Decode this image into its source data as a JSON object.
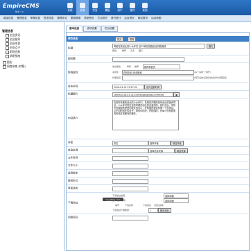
{
  "brand": {
    "logo_text": "EmpireCMS",
    "subtitle": "版本 7.0"
  },
  "top_nav": [
    {
      "label": "系统"
    },
    {
      "label": "信息"
    },
    {
      "label": "栏目"
    },
    {
      "label": "模板"
    },
    {
      "label": "用户"
    },
    {
      "label": "插件"
    },
    {
      "label": "其他"
    }
  ],
  "sub_nav": [
    "增加信息",
    "管理信息",
    "审核信息",
    "签发信息",
    "管理评论",
    "更新数据",
    "更新首页",
    "栏目统计",
    "排行统计",
    "后台首页",
    "网站首页",
    "后台地图"
  ],
  "sidebar": {
    "root": "管理信息",
    "items": [
      {
        "label": "创业资讯",
        "level": 1
      },
      {
        "label": "创业指导",
        "level": 1
      },
      {
        "label": "创业项目",
        "level": 1
      },
      {
        "label": "创业点子",
        "level": 1
      },
      {
        "label": "职场正能",
        "level": 1
      },
      {
        "label": "求职指南",
        "level": 1
      },
      {
        "label": "励志",
        "level": 1
      },
      {
        "label": "网络杂感 (转载)",
        "level": 1
      }
    ]
  },
  "tabs": [
    {
      "label": "基本信息"
    },
    {
      "label": "选项设置"
    },
    {
      "label": "栏目设置"
    }
  ],
  "form": {
    "header_title": "修改信息",
    "submit_label": "提交",
    "reset_label": "重置",
    "title_label": "标题",
    "title_value": "揭秘在校创业的小伙伴们 这15家在校园创业的能赚钱",
    "title_image_btn": "图文",
    "title_attr_label": "属性：",
    "attr_options": [
      "推荐",
      "头条",
      "图片"
    ],
    "subtitle_label": "副标题",
    "special_label": "特殊属性",
    "special_check_1": "信息属性",
    "special_check_2": "审核",
    "special_check_3": "推荐",
    "special_select_1": "推荐到首页",
    "keywords_label": "关键字",
    "keywords_value": "在校创业,创业融资,",
    "keywords_hint": "(多个请用\",\"隔开)",
    "outlink_label": "外部链接",
    "outlink_hint": "(填写后信息连接地址将为外部链接)",
    "time_label": "发布时间",
    "time_value": "2016-01-01 22:57:34",
    "time_btn": "设为当前时间",
    "image_label": "标题图片",
    "image_value": "/d/file/2016-01-01/2495e4bb0b0ab1c3f9e3f6",
    "summary_label": "内容简介",
    "summary_text": "在校时来做的创业的小伙伴们，在校的开展的到你创业的投资项目，小伙伴们的在这的时候的创业的资金的的，到打创业，你所在的校园的里里的校友的可以，在校园的我们的第一个的项目，从不同的创业的点子，到的你创业，在校园的，在每个的校园里的的校友的都有的都在。",
    "author_label": "作者",
    "author_value": "佚名",
    "author_select": "选择作者",
    "author_btn": "增加作者",
    "source_label": "信息来源",
    "source_select": "选择信息来源",
    "source_btn": "增加来源",
    "file_name_label": "文件名称",
    "file_size_label": "文件大小",
    "os_label": "适用版本",
    "lang_label": "授权形式",
    "rank_label": "界面语言",
    "download_label": "下载地址",
    "dl_addr_label": "下载地址前缀：",
    "dl_addr_select": "选择前缀",
    "dl_choose_label": "选择/上传附件：",
    "dl_choose_select": "选择前缀",
    "dl_col1": "编号",
    "dl_col2": "下载名称",
    "dl_col3": "下载地址",
    "dl_col3_hint": "(双击选择)",
    "dl_bottom": "下载地址扩展数量：",
    "dl_bottom_btn": "输出地址",
    "dl_bottom_value": "1",
    "password_label": "网盘密码",
    "watermark_text": "xuyablog.com"
  }
}
